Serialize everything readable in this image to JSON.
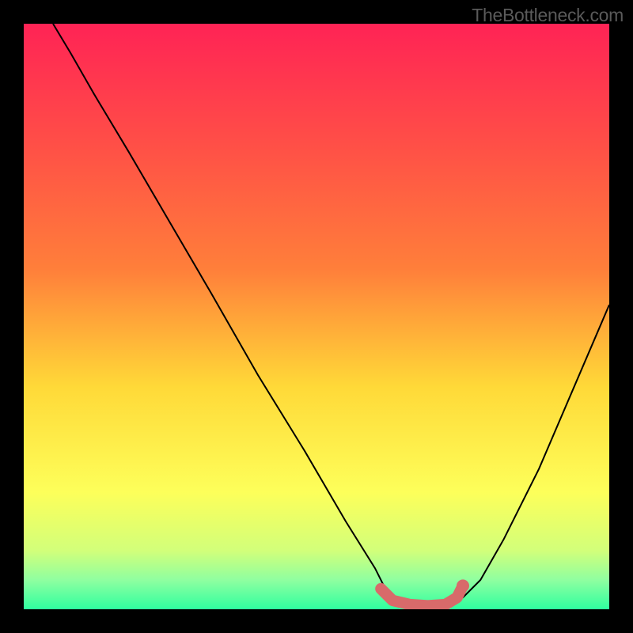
{
  "watermark": "TheBottleneck.com",
  "chart_data": {
    "type": "line",
    "title": "",
    "xlabel": "",
    "ylabel": "",
    "xlim": [
      0,
      100
    ],
    "ylim": [
      0,
      100
    ],
    "background_gradient": {
      "top": "#ff2355",
      "upper_mid": "#ff7f3a",
      "mid": "#ffd938",
      "lower_mid": "#fdff5a",
      "near_bottom": "#d2ff7a",
      "bottom": "#2fff9f"
    },
    "series": [
      {
        "name": "curve",
        "color": "#000000",
        "x": [
          5,
          8,
          12,
          18,
          25,
          32,
          40,
          48,
          55,
          60,
          62,
          65,
          68,
          71,
          73,
          75,
          78,
          82,
          88,
          94,
          100
        ],
        "y": [
          100,
          95,
          88,
          78,
          66,
          54,
          40,
          27,
          15,
          7,
          3,
          1,
          0.5,
          0.5,
          1,
          2,
          5,
          12,
          24,
          38,
          52
        ]
      },
      {
        "name": "highlight-segment",
        "color": "#d86a6a",
        "stroke_width": 9,
        "x": [
          61,
          63,
          66,
          69,
          72,
          74,
          75
        ],
        "y": [
          3.5,
          1.5,
          0.8,
          0.6,
          0.8,
          2.0,
          4.0
        ]
      }
    ],
    "points": [
      {
        "name": "highlight-end-dot",
        "x": 75,
        "y": 4.0,
        "r": 5,
        "color": "#d86a6a"
      }
    ]
  }
}
